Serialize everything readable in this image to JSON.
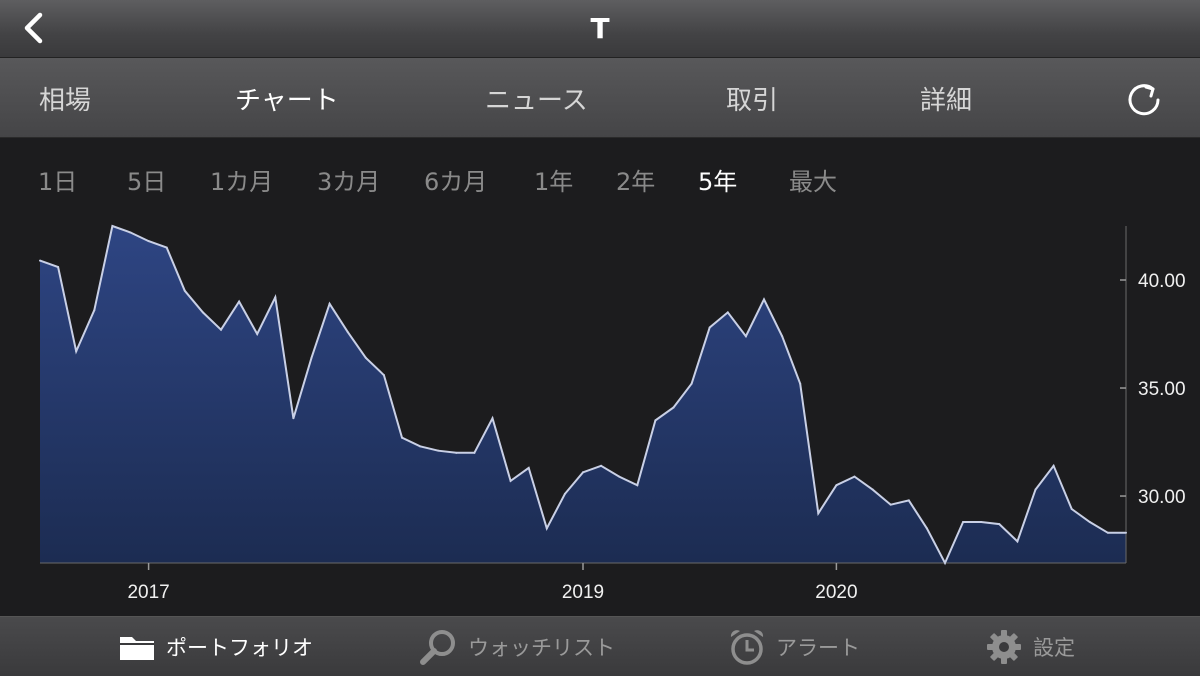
{
  "header": {
    "title": "T",
    "back_icon": "chevron-left-icon"
  },
  "tabs": [
    {
      "label": "相場",
      "active": false
    },
    {
      "label": "チャート",
      "active": true
    },
    {
      "label": "ニュース",
      "active": false
    },
    {
      "label": "取引",
      "active": false
    },
    {
      "label": "詳細",
      "active": false
    }
  ],
  "refresh_icon": "refresh-icon",
  "ranges": [
    {
      "label": "1日",
      "active": false
    },
    {
      "label": "5日",
      "active": false
    },
    {
      "label": "1カ月",
      "active": false
    },
    {
      "label": "3カ月",
      "active": false
    },
    {
      "label": "6カ月",
      "active": false
    },
    {
      "label": "1年",
      "active": false
    },
    {
      "label": "2年",
      "active": false
    },
    {
      "label": "5年",
      "active": true
    },
    {
      "label": "最大",
      "active": false
    }
  ],
  "bottom_nav": [
    {
      "label": "ポートフォリオ",
      "icon": "folder-icon",
      "active": true
    },
    {
      "label": "ウォッチリスト",
      "icon": "magnifier-icon",
      "active": false
    },
    {
      "label": "アラート",
      "icon": "alarm-clock-icon",
      "active": false
    },
    {
      "label": "設定",
      "icon": "gear-icon",
      "active": false
    }
  ],
  "colors": {
    "area_fill_top": "#2e4583",
    "area_fill_bottom": "#1c2c52",
    "line": "#c9d0e6"
  },
  "chart_data": {
    "type": "area",
    "x": [
      "2016-07",
      "2016-08",
      "2016-09",
      "2016-10",
      "2016-11",
      "2016-12",
      "2017-01",
      "2017-02",
      "2017-03",
      "2017-04",
      "2017-05",
      "2017-06",
      "2017-07",
      "2017-08",
      "2017-09",
      "2017-10",
      "2017-11",
      "2017-12",
      "2018-01",
      "2018-02",
      "2018-03",
      "2018-04",
      "2018-05",
      "2018-06",
      "2018-07",
      "2018-08",
      "2018-09",
      "2018-10",
      "2018-11",
      "2018-12",
      "2019-01",
      "2019-02",
      "2019-03",
      "2019-04",
      "2019-05",
      "2019-06",
      "2019-07",
      "2019-08",
      "2019-09",
      "2019-10",
      "2019-11",
      "2019-12",
      "2020-01",
      "2020-02",
      "2020-03",
      "2020-04",
      "2020-05",
      "2020-06",
      "2020-07",
      "2020-08",
      "2020-09",
      "2020-10",
      "2020-11",
      "2020-12",
      "2021-01",
      "2021-02",
      "2021-03",
      "2021-04",
      "2021-05",
      "2021-06",
      "2021-07"
    ],
    "values": [
      40.9,
      40.6,
      36.7,
      38.6,
      42.5,
      42.2,
      41.8,
      41.5,
      39.5,
      38.5,
      37.7,
      39.0,
      37.5,
      39.2,
      33.6,
      36.4,
      38.9,
      37.6,
      36.4,
      35.6,
      32.7,
      32.3,
      32.1,
      32.0,
      32.0,
      33.6,
      30.7,
      31.3,
      28.5,
      30.1,
      31.1,
      31.4,
      30.9,
      30.5,
      33.5,
      34.1,
      35.2,
      37.8,
      38.5,
      37.4,
      39.1,
      37.4,
      35.2,
      29.2,
      30.5,
      30.9,
      30.3,
      29.6,
      29.8,
      28.5,
      26.9,
      28.8,
      28.8,
      28.7,
      27.9,
      30.3,
      31.4,
      29.4,
      28.8,
      28.3,
      28.3
    ],
    "x_ticks": [
      {
        "label": "2017",
        "x": "2017-01"
      },
      {
        "label": "2019",
        "x": "2019-01"
      },
      {
        "label": "2020",
        "x": "2020-03"
      }
    ],
    "y_ticks": [
      {
        "label": "40.00",
        "value": 40
      },
      {
        "label": "35.00",
        "value": 35
      },
      {
        "label": "30.00",
        "value": 30
      }
    ],
    "ylim": [
      26.9,
      42.5
    ],
    "y_axis_position": "right"
  }
}
